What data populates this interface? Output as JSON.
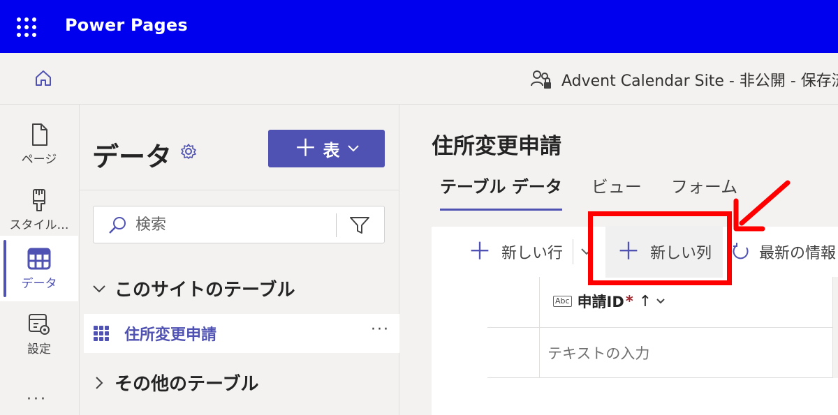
{
  "appbar": {
    "title": "Power Pages",
    "waffle_icon": "waffle-icon"
  },
  "subbar": {
    "site_status": "Advent Calendar Site - 非公開 - 保存済"
  },
  "rail": {
    "items": [
      {
        "label": "ページ",
        "icon": "page-icon"
      },
      {
        "label": "スタイル…",
        "icon": "brush-icon"
      },
      {
        "label": "データ",
        "icon": "table-icon",
        "active": true
      },
      {
        "label": "設定",
        "icon": "settings-icon"
      }
    ],
    "more": "···"
  },
  "panel": {
    "title": "データ",
    "new_table_label": "表",
    "search_placeholder": "検索",
    "section_this_site": "このサイトのテーブル",
    "section_other": "その他のテーブル",
    "table_item": "住所変更申請",
    "more": "···"
  },
  "main": {
    "title": "住所変更申請",
    "tabs": [
      {
        "label": "テーブル データ",
        "active": true
      },
      {
        "label": "ビュー"
      },
      {
        "label": "フォーム"
      }
    ],
    "commands": {
      "new_row": "新しい行",
      "new_column": "新しい列",
      "refresh": "最新の情報"
    },
    "column_header": {
      "type_badge": "Abc",
      "name": "申請ID",
      "required": "*",
      "sort": "↑"
    },
    "cell_placeholder": "テキストの入力"
  },
  "colors": {
    "appbar": "#0000EE",
    "accent": "#4F52B2",
    "annotation": "#FF0000"
  }
}
